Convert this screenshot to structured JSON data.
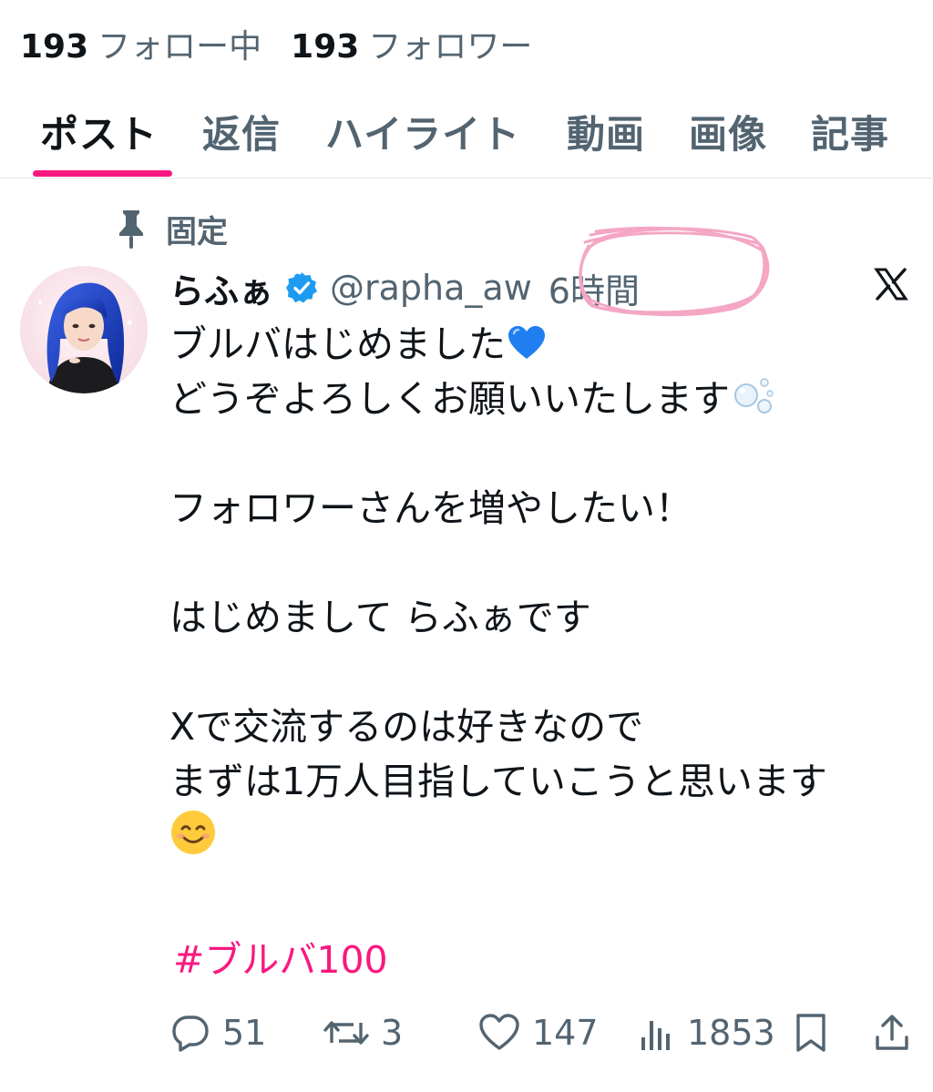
{
  "stats": {
    "following_count": "193",
    "following_label": "フォロー中",
    "followers_count": "193",
    "followers_label": "フォロワー"
  },
  "tabs": [
    {
      "label": "ポスト",
      "active": true
    },
    {
      "label": "返信"
    },
    {
      "label": "ハイライト"
    },
    {
      "label": "動画"
    },
    {
      "label": "画像"
    },
    {
      "label": "記事"
    }
  ],
  "pinned_label": "固定",
  "post": {
    "author_name": "らふぁ",
    "handle": "@rapha_aw",
    "time": "6時間",
    "lines": [
      "ブルバはじめました",
      "どうぞよろしくお願いいたします",
      "",
      "フォロワーさんを増やしたい！",
      "",
      "はじめまして らふぁです",
      "",
      "Xで交流するのは好きなので",
      "まずは1万人目指していこうと思います",
      ""
    ],
    "hashtag": "#ブルバ100",
    "emojis": [
      "blue-heart",
      "bubbles",
      "smiling-face"
    ]
  },
  "actions": {
    "replies": "51",
    "reposts": "3",
    "likes": "147",
    "views": "1853"
  },
  "colors": {
    "accent": "#f91880",
    "verified": "#1d9bf0",
    "muted": "#536471",
    "text": "#0f1419",
    "scribble": "#f4a6c4"
  },
  "icons": [
    "pin-icon",
    "verified-badge-icon",
    "x-logo-icon",
    "reply-icon",
    "repost-icon",
    "like-icon",
    "views-icon",
    "bookmark-icon",
    "share-icon"
  ]
}
